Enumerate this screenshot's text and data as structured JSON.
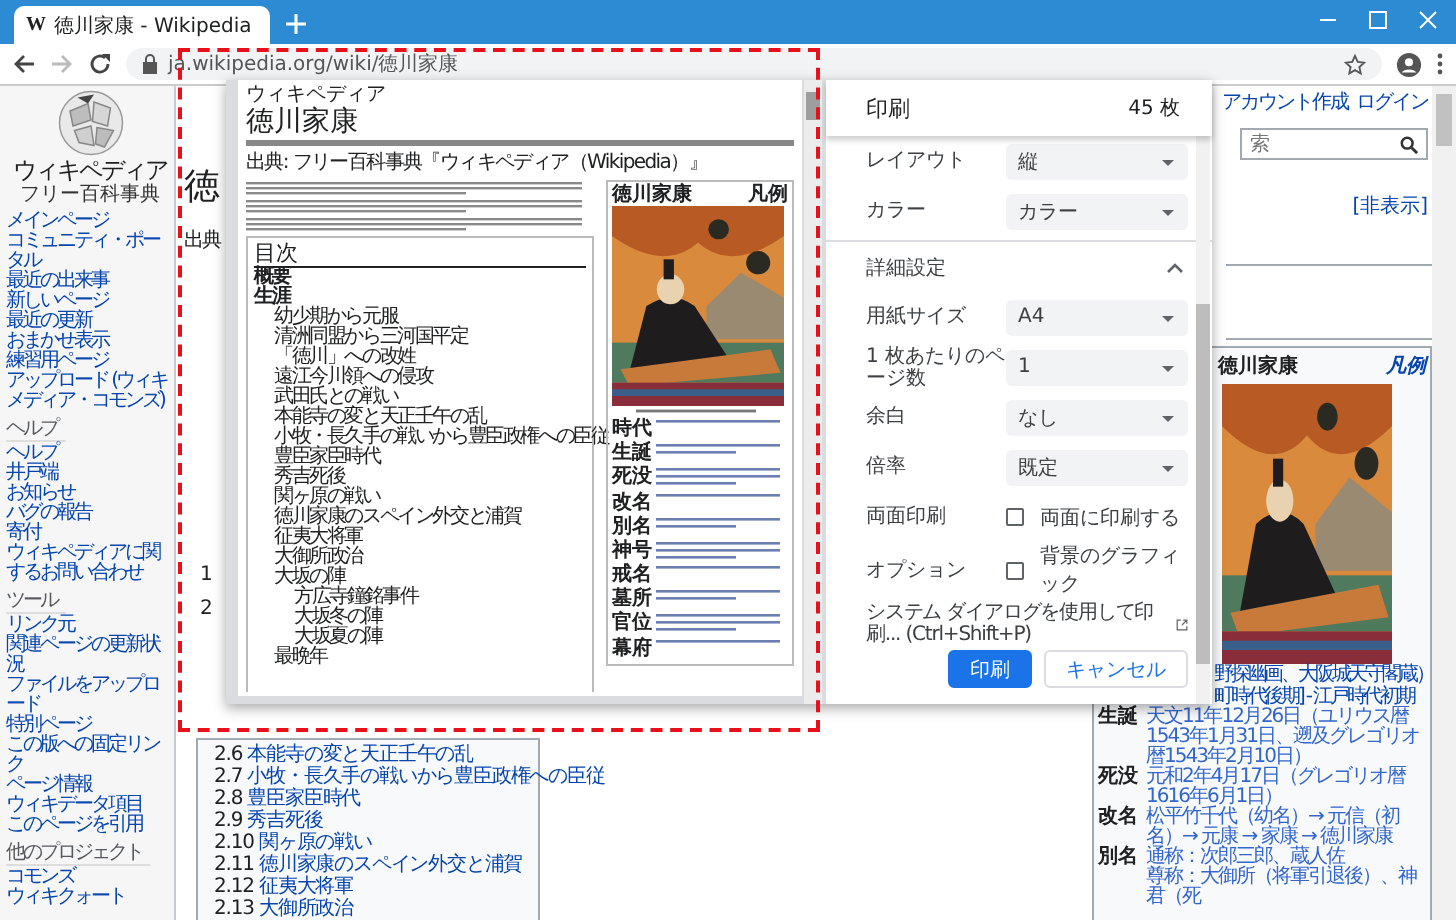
{
  "browser": {
    "tab": {
      "favicon": "W",
      "title": "徳川家康 - Wikipedia"
    },
    "url": "ja.wikipedia.org/wiki/徳川家康"
  },
  "sidebar": {
    "logo_title": "ウィキペディア",
    "logo_subtitle": "フリー百科事典",
    "sections": [
      {
        "items": [
          "メインページ",
          "コミュニティ・ポータル",
          "最近の出来事",
          "新しいページ",
          "最近の更新",
          "おまかせ表示",
          "練習用ページ",
          "アップロード (ウィキメディア・コモンズ)"
        ]
      },
      {
        "heading": "ヘルプ",
        "items": [
          "ヘルプ",
          "井戸端",
          "お知らせ",
          "バグの報告",
          "寄付",
          "ウィキペディアに関するお問い合わせ"
        ]
      },
      {
        "heading": "ツール",
        "items": [
          "リンク元",
          "関連ページの更新状況",
          "ファイルをアップロード",
          "特別ページ",
          "この版への固定リンク",
          "ページ情報",
          "ウィキデータ項目",
          "このページを引用"
        ]
      },
      {
        "heading": "他のプロジェクト",
        "items": [
          "コモンズ",
          "ウィキクォート"
        ]
      }
    ]
  },
  "article": {
    "heading": "徳",
    "source": "出典",
    "toc_numbers": [
      "1",
      "2"
    ],
    "toc": [
      {
        "number": "2.6",
        "title": "本能寺の変と天正壬午の乱"
      },
      {
        "number": "2.7",
        "title": "小牧・長久手の戦いから豊臣政権への臣従"
      },
      {
        "number": "2.8",
        "title": "豊臣家臣時代"
      },
      {
        "number": "2.9",
        "title": "秀吉死後"
      },
      {
        "number": "2.10",
        "title": "関ヶ原の戦い"
      },
      {
        "number": "2.11",
        "title": "徳川家康のスペイン外交と浦賀"
      },
      {
        "number": "2.12",
        "title": "征夷大将軍"
      },
      {
        "number": "2.13",
        "title": "大御所政治"
      }
    ]
  },
  "user_links": [
    "アカウント作成",
    "ログイン"
  ],
  "search": {
    "placeholder": "索"
  },
  "hide_link": "[非表示]",
  "infobox": {
    "title": "徳川家康",
    "legend": "凡例",
    "kind": "picture",
    "caption": [
      "野探幽画、大阪城天守閣蔵）",
      "町時代後期] - 江戸時代初期"
    ],
    "rows": [
      {
        "label": "生誕",
        "value": "天文11年12月26日（ユリウス暦1543年1月31日、遡及グレゴリオ暦1543年2月10日）"
      },
      {
        "label": "死没",
        "value": "元和2年4月17日（グレゴリオ暦1616年6月1日）"
      },
      {
        "label": "改名",
        "value": "松平竹千代（幼名）→ 元信（初名）→ 元康 → 家康 → 徳川家康"
      },
      {
        "label": "別名",
        "value": "通称：次郎三郎、蔵人佐"
      },
      {
        "label": "",
        "value": "尊称：大御所（将軍引退後）、神君（死"
      }
    ]
  },
  "print_dialog": {
    "title": "印刷",
    "sheets": "45 枚",
    "settings": [
      {
        "kind": "select",
        "label": "レイアウト",
        "value": "縦"
      },
      {
        "kind": "select",
        "label": "カラー",
        "value": "カラー"
      },
      {
        "kind": "section",
        "label": "詳細設定",
        "expanded": true
      },
      {
        "kind": "select",
        "label": "用紙サイズ",
        "value": "A4"
      },
      {
        "kind": "select",
        "label": "1 枚あたりのページ数",
        "value": "1"
      },
      {
        "kind": "select",
        "label": "余白",
        "value": "なし"
      },
      {
        "kind": "select",
        "label": "倍率",
        "value": "既定"
      },
      {
        "kind": "checkbox",
        "label": "両面印刷",
        "text": "両面に印刷する",
        "checked": false
      },
      {
        "kind": "checkbox",
        "label": "オプション",
        "text": "背景のグラフィック",
        "checked": false
      }
    ],
    "system_dialog": "システム ダイアログを使用して印刷... (Ctrl+Shift+P)",
    "buttons": [
      {
        "label": "印刷",
        "kind": "primary"
      },
      {
        "label": "キャンセル",
        "kind": "secondary"
      }
    ]
  },
  "preview": {
    "site": "ウィキペディア",
    "title": "徳川家康",
    "source": "出典: フリー百科事典『ウィキペディア（Wikipedia）』",
    "toc_title": "目次",
    "toc": [
      {
        "title": "概要",
        "bold": true
      },
      {
        "title": "生涯",
        "bold": true,
        "children": [
          {
            "title": "幼少期から元服"
          },
          {
            "title": "清洲同盟から三河国平定"
          },
          {
            "title": "「徳川」への改姓"
          },
          {
            "title": "遠江今川領への侵攻"
          },
          {
            "title": "武田氏との戦い"
          },
          {
            "title": "本能寺の変と天正壬午の乱"
          },
          {
            "title": "小牧・長久手の戦いから豊臣政権への臣従"
          },
          {
            "title": "豊臣家臣時代"
          },
          {
            "title": "秀吉死後"
          },
          {
            "title": "関ヶ原の戦い"
          },
          {
            "title": "徳川家康のスペイン外交と浦賀"
          },
          {
            "title": "征夷大将軍"
          },
          {
            "title": "大御所政治"
          },
          {
            "title": "大坂の陣",
            "children": [
              {
                "title": "方広寺鐘銘事件"
              },
              {
                "title": "大坂冬の陣"
              },
              {
                "title": "大坂夏の陣"
              }
            ]
          },
          {
            "title": "最晩年"
          }
        ]
      }
    ],
    "infobox": {
      "title": "徳川家康",
      "legend": "凡例",
      "kind": "picture",
      "rows": [
        "時代",
        "生誕",
        "死没",
        "改名",
        "別名",
        "神号",
        "戒名",
        "墓所",
        "官位",
        "幕府"
      ]
    }
  }
}
